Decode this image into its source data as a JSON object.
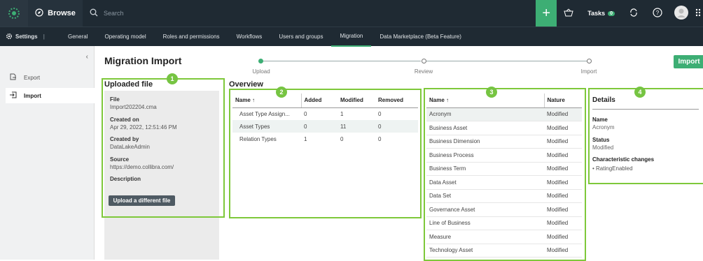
{
  "topbar": {
    "browse_label": "Browse",
    "search_placeholder": "Search",
    "tasks_label": "Tasks",
    "tasks_count": "0"
  },
  "subnav": {
    "settings_label": "Settings",
    "items": [
      "General",
      "Operating model",
      "Roles and permissions",
      "Workflows",
      "Users and groups",
      "Migration",
      "Data Marketplace (Beta Feature)"
    ],
    "active": "Migration"
  },
  "leftnav": {
    "items": [
      {
        "label": "Export",
        "icon": "export-icon"
      },
      {
        "label": "Import",
        "icon": "import-icon"
      }
    ]
  },
  "page": {
    "title": "Migration Import",
    "import_button": "Import"
  },
  "stepper": {
    "steps": [
      "Upload",
      "Review",
      "Import"
    ],
    "current": "Upload"
  },
  "uploaded_file": {
    "title": "Uploaded file",
    "badge": "1",
    "file_label": "File",
    "file_value": "Import202204.cma",
    "created_on_label": "Created on",
    "created_on_value": "Apr 29, 2022, 12:51:46 PM",
    "created_by_label": "Created by",
    "created_by_value": "DataLakeAdmin",
    "source_label": "Source",
    "source_value": "https://demo.collibra.com/",
    "description_label": "Description",
    "upload_button": "Upload a different file"
  },
  "overview": {
    "title": "Overview",
    "badge": "2",
    "headers": [
      "Name ↑",
      "Added",
      "Modified",
      "Removed"
    ],
    "rows": [
      {
        "name": "Asset Type Assign...",
        "added": "0",
        "modified": "1",
        "removed": "0"
      },
      {
        "name": "Asset Types",
        "added": "0",
        "modified": "11",
        "removed": "0"
      },
      {
        "name": "Relation Types",
        "added": "1",
        "modified": "0",
        "removed": "0"
      }
    ]
  },
  "changes": {
    "badge": "3",
    "headers": [
      "Name ↑",
      "Nature"
    ],
    "rows": [
      {
        "name": "Acronym",
        "nature": "Modified"
      },
      {
        "name": "Business Asset",
        "nature": "Modified"
      },
      {
        "name": "Business Dimension",
        "nature": "Modified"
      },
      {
        "name": "Business Process",
        "nature": "Modified"
      },
      {
        "name": "Business Term",
        "nature": "Modified"
      },
      {
        "name": "Data Asset",
        "nature": "Modified"
      },
      {
        "name": "Data Set",
        "nature": "Modified"
      },
      {
        "name": "Governance Asset",
        "nature": "Modified"
      },
      {
        "name": "Line of Business",
        "nature": "Modified"
      },
      {
        "name": "Measure",
        "nature": "Modified"
      },
      {
        "name": "Technology Asset",
        "nature": "Modified"
      }
    ]
  },
  "details": {
    "title": "Details",
    "badge": "4",
    "name_label": "Name",
    "name_value": "Acronym",
    "status_label": "Status",
    "status_value": "Modified",
    "changes_label": "Characteristic changes",
    "changes_items": [
      "RatingEnabled"
    ]
  },
  "colors": {
    "accent": "#3dae74",
    "highlight_box": "#7ec83a",
    "topbar": "#1f2a33"
  }
}
